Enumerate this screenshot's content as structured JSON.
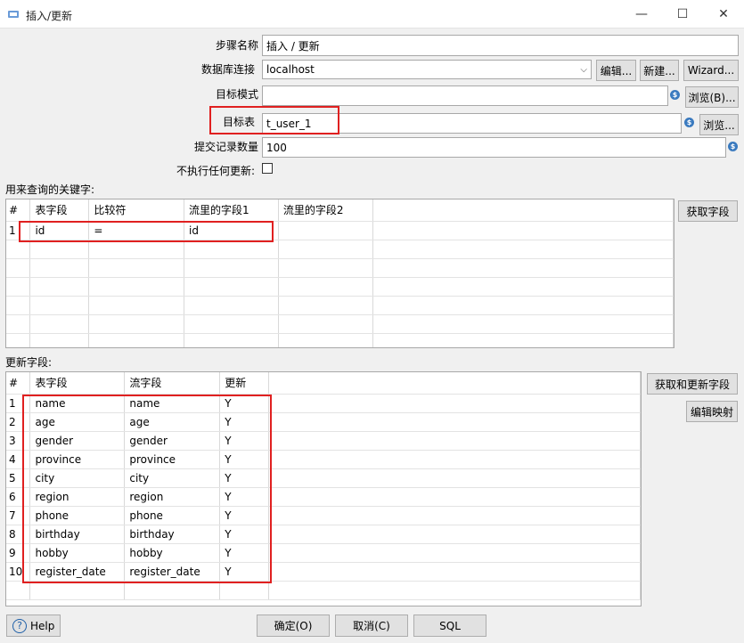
{
  "window": {
    "title": "插入/更新",
    "minimize_icon": "—",
    "maximize_icon": "☐",
    "close_icon": "✕"
  },
  "form": {
    "step_name_label": "步骤名称",
    "step_name_value": "插入 / 更新",
    "connection_label": "数据库连接",
    "connection_value": "localhost",
    "edit_button": "编辑...",
    "new_button": "新建...",
    "wizard_button": "Wizard...",
    "schema_label": "目标模式",
    "schema_value": "",
    "browse_b_button": "浏览(B)...",
    "table_label": "目标表",
    "table_value": "t_user_1",
    "browse_button": "浏览...",
    "commit_label": "提交记录数量",
    "commit_value": "100",
    "no_update_label": "不执行任何更新:",
    "no_update_checked": false
  },
  "keys": {
    "section_label": "用来查询的关键字:",
    "get_fields_button": "获取字段",
    "headers": [
      "#",
      "表字段",
      "比较符",
      "流里的字段1",
      "流里的字段2"
    ],
    "rows": [
      [
        "1",
        "id",
        "=",
        "id",
        ""
      ]
    ]
  },
  "update": {
    "section_label": "更新字段:",
    "get_update_fields_button": "获取和更新字段",
    "edit_mapping_button": "编辑映射",
    "headers": [
      "#",
      "表字段",
      "流字段",
      "更新"
    ],
    "rows": [
      [
        "1",
        "name",
        "name",
        "Y"
      ],
      [
        "2",
        "age",
        "age",
        "Y"
      ],
      [
        "3",
        "gender",
        "gender",
        "Y"
      ],
      [
        "4",
        "province",
        "province",
        "Y"
      ],
      [
        "5",
        "city",
        "city",
        "Y"
      ],
      [
        "6",
        "region",
        "region",
        "Y"
      ],
      [
        "7",
        "phone",
        "phone",
        "Y"
      ],
      [
        "8",
        "birthday",
        "birthday",
        "Y"
      ],
      [
        "9",
        "hobby",
        "hobby",
        "Y"
      ],
      [
        "10",
        "register_date",
        "register_date",
        "Y"
      ]
    ]
  },
  "footer": {
    "help_button": "Help",
    "ok_button": "确定(O)",
    "cancel_button": "取消(C)",
    "sql_button": "SQL"
  },
  "icons": {
    "variable_icon": "$",
    "help_icon": "?",
    "combo_arrow": "⌵"
  },
  "colors": {
    "highlight": "#e02020",
    "variable_icon": "#3a7abf"
  }
}
